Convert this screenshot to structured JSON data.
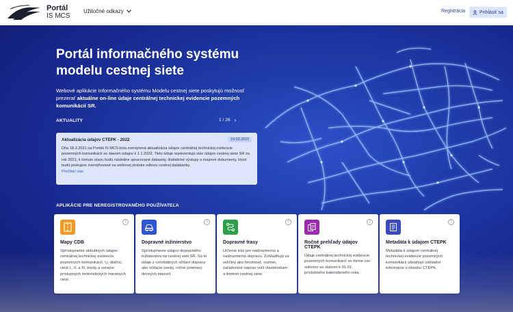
{
  "header": {
    "logo_alt": "SLOVENSKÁ SPRÁVA CIEST",
    "logo_title": "Portál",
    "logo_sub": "IS MCS",
    "links_label": "Užitočné odkazy",
    "register": "Registrácia",
    "login": "Prihlásiť sa"
  },
  "hero": {
    "title": "Portál informačného systému modelu cestnej siete",
    "desc_part1": "Webové aplikácie Informačného systému Modelu cestnej siete poskytujú možnosť prezerať ",
    "desc_bold": "aktuálne on-line údaje centrálnej technickej evidencie pozemných komunikácií SR."
  },
  "news": {
    "label": "AKTUALITY",
    "pager": "1 / 26",
    "title": "Aktualizácia údajov CTEPK - 2022",
    "date": "19.03.2022",
    "body": "Dňa 18.3.2021 na Portáli IS MCS bola zverejnená aktualizácia údajov centrálnej technickej evidencie pozemných komunikácií so stavom údajov k 1.1.2022. Tieto údaje reprezentujú stav údajov cestnej siete SR za rok 2021; k tomuto stavu budú následne spracované datasety, štatistické výstupy a mapové dokumenty, ktoré budú postupne zverejňované na webovej stránke odboru cestnej databanky.",
    "more": "Prečítať viac"
  },
  "apps": {
    "label": "APLIKÁCIE PRE NEREGISTROVANÉHO POUŽÍVATEĽA",
    "help_glyph": "?",
    "items": [
      {
        "title": "Mapy CDB",
        "desc": "Sprístupnenie aktuálnych údajov centrálnej technickej evidencie pozemných komunikácií, t.j. diaľnic, ciest I., II. a III. triedy a verejne prístupných motoristických miestnych ciest.",
        "icon": "road-icon",
        "color": "#f29a1f"
      },
      {
        "title": "Dopravné inžinierstvo",
        "desc": "Sprístupnenie údajov dopravného inžinierstva na cestnej sieti SR. Sú to údaje z celoštátnych sčítaní dopravy ako sčítacie úseky, ročné priemery denných intenzít.",
        "icon": "car-icon",
        "color": "#2f55d4"
      },
      {
        "title": "Dopravné trasy",
        "desc": "Určenie trás pre nadrozmernú a nadrozmernú dopravu. Zohľadňujú sa veličiny ako hmotnosť, rozmer, zaťaženosť náprav voči vlastnostiam a limitom cestnej siete.",
        "icon": "route-icon",
        "color": "#2e9e4a"
      },
      {
        "title": "Ročné prehľady údajov CTEPK",
        "desc": "Údaje centrálnej technickej evidencie pozemných komunikácií vo forme csv súborov so stavom k 01.01. príslušného kalendárneho roka.",
        "icon": "files-icon",
        "color": "#9b2bb0"
      },
      {
        "title": "Metadáta k údajom CTEPK",
        "desc": "Metadáta k údajom centrálnej technickej evidencie pozemných komunikácií obsahujú základné informácie o obsahu CTEPK.",
        "icon": "document-icon",
        "color": "#3b4cc0"
      }
    ]
  }
}
